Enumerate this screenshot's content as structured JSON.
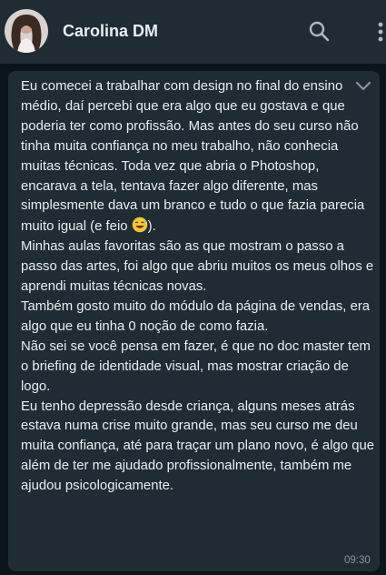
{
  "header": {
    "contact_name": "Carolina DM",
    "icons": [
      "avatar",
      "search-icon",
      "more-vert-icon"
    ]
  },
  "message": {
    "paragraphs": {
      "p1_before_emoji": "Eu comecei a trabalhar com design no final do ensino médio, daí percebi que era algo que eu gostava e que poderia ter como profissão. Mas antes do seu curso não tinha muita confiança no meu trabalho, não conhecia muitas técnicas. Toda vez que abria o Photoshop, encarava a tela, tentava fazer algo diferente, mas simplesmente dava um branco e tudo o que fazia parecia muito igual (e feio ",
      "p1_after_emoji": ").",
      "p2": "Minhas aulas favoritas são as que mostram o passo a passo das artes, foi algo que abriu muitos os meus olhos e aprendi muitas técnicas novas.",
      "p3": "Também gosto muito do módulo da página de vendas, era algo que eu tinha 0 noção de como fazia.",
      "p4": "Não sei se você pensa em fazer, é que no doc master tem o briefing de identidade visual, mas mostrar criação de logo.",
      "p5": "Eu tenho depressão desde criança, alguns meses atrás estava numa crise muito grande, mas seu curso me deu muita confiança, até para traçar um plano novo, é algo que além de ter me ajudado profissionalmente, também me ajudou psicologicamente."
    },
    "emoji": "sweat-smile-emoji",
    "time": "09:30"
  },
  "colors": {
    "background": "#0b141a",
    "header": "#1f2c34",
    "bubble": "#1f2c34",
    "text": "#e9edef",
    "meta": "#8696a0"
  }
}
